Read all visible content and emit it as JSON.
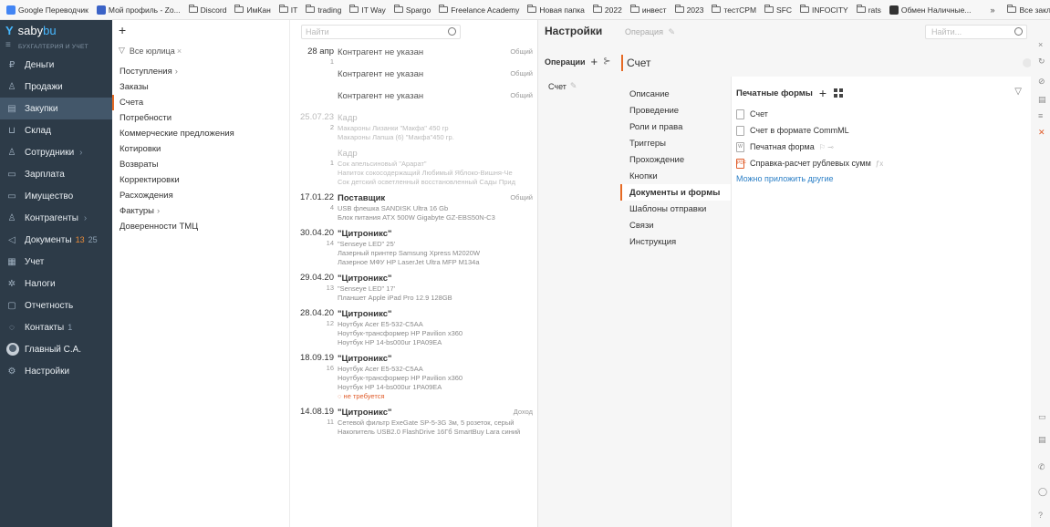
{
  "bookmarks": {
    "items": [
      {
        "label": "Google Переводчик",
        "type": "site",
        "color": "#4285f4"
      },
      {
        "label": "Мой профиль - Zo...",
        "type": "site",
        "color": "#3b63c7"
      },
      {
        "label": "Discord",
        "type": "folder"
      },
      {
        "label": "ИмКан",
        "type": "folder"
      },
      {
        "label": "IT",
        "type": "folder"
      },
      {
        "label": "trading",
        "type": "folder"
      },
      {
        "label": "IT Way",
        "type": "folder"
      },
      {
        "label": "Spargo",
        "type": "folder"
      },
      {
        "label": "Freelance Academy",
        "type": "folder"
      },
      {
        "label": "Новая папка",
        "type": "folder"
      },
      {
        "label": "2022",
        "type": "folder"
      },
      {
        "label": "инвест",
        "type": "folder"
      },
      {
        "label": "2023",
        "type": "folder"
      },
      {
        "label": "тестCPM",
        "type": "folder"
      },
      {
        "label": "SFC",
        "type": "folder"
      },
      {
        "label": "INFOCITY",
        "type": "folder"
      },
      {
        "label": "rats",
        "type": "folder"
      },
      {
        "label": "Обмен Наличные...",
        "type": "site",
        "color": "#333333"
      }
    ],
    "more": "»",
    "all_label": "Все заклад"
  },
  "sidebar": {
    "logo_a": "saby",
    "logo_b": "bu",
    "subtitle": "БУХГАЛТЕРИЯ И УЧЕТ",
    "items": [
      {
        "label": "Деньги",
        "icon": "₽",
        "arrow": "",
        "count": "",
        "count2": ""
      },
      {
        "label": "Продажи",
        "icon": "♙",
        "arrow": "",
        "count": "",
        "count2": ""
      },
      {
        "label": "Закупки",
        "icon": "▤",
        "arrow": "",
        "count": "",
        "count2": ""
      },
      {
        "label": "Склад",
        "icon": "⊔",
        "arrow": "",
        "count": "",
        "count2": ""
      },
      {
        "label": "Сотрудники",
        "icon": "♙",
        "arrow": "›",
        "count": "",
        "count2": ""
      },
      {
        "label": "Зарплата",
        "icon": "▭",
        "arrow": "",
        "count": "",
        "count2": ""
      },
      {
        "label": "Имущество",
        "icon": "▭",
        "arrow": "",
        "count": "",
        "count2": ""
      },
      {
        "label": "Контрагенты",
        "icon": "♙",
        "arrow": "›",
        "count": "",
        "count2": ""
      },
      {
        "label": "Документы",
        "icon": "◁",
        "arrow": "",
        "count": "13",
        "count2": "25"
      },
      {
        "label": "Учет",
        "icon": "▦",
        "arrow": "",
        "count": "",
        "count2": ""
      },
      {
        "label": "Налоги",
        "icon": "✲",
        "arrow": "",
        "count": "",
        "count2": ""
      },
      {
        "label": "Отчетность",
        "icon": "▢",
        "arrow": "",
        "count": "",
        "count2": ""
      },
      {
        "label": "Контакты",
        "icon": "◌",
        "arrow": "",
        "count": "",
        "count2": "1"
      },
      {
        "label": "Главный С.А.",
        "icon": "avatar",
        "arrow": "",
        "count": "",
        "count2": ""
      },
      {
        "label": "Настройки",
        "icon": "⚙",
        "arrow": "",
        "count": "",
        "count2": ""
      }
    ],
    "active_index": 2,
    "accent": "#47b8ff"
  },
  "col2": {
    "plus": "+",
    "filter_label": "Все юрлица",
    "items": [
      {
        "label": "Поступления",
        "arrow": "›"
      },
      {
        "label": "Заказы",
        "arrow": ""
      },
      {
        "label": "Счета",
        "arrow": ""
      },
      {
        "label": "Потребности",
        "arrow": ""
      },
      {
        "label": "Коммерческие предложения",
        "arrow": ""
      },
      {
        "label": "Котировки",
        "arrow": ""
      },
      {
        "label": "Возвраты",
        "arrow": ""
      },
      {
        "label": "Корректировки",
        "arrow": ""
      },
      {
        "label": "Расхождения",
        "arrow": ""
      },
      {
        "label": "Фактуры",
        "arrow": "›"
      },
      {
        "label": "Доверенности ТМЦ",
        "arrow": ""
      }
    ],
    "selected_index": 2
  },
  "list": {
    "search_placeholder": "Найти",
    "rows": [
      {
        "date": "28 апр",
        "num": "1",
        "title": "Контрагент не указан",
        "tag": "Общий",
        "muted": false,
        "bold": false,
        "subs": []
      },
      {
        "date": "",
        "num": "",
        "title": "Контрагент не указан",
        "tag": "Общий",
        "muted": false,
        "bold": false,
        "subs": []
      },
      {
        "date": "",
        "num": "",
        "title": "Контрагент не указан",
        "tag": "Общий",
        "muted": false,
        "bold": false,
        "subs": []
      },
      {
        "date": "25.07.23",
        "num": "2",
        "title": "Кадр",
        "tag": "",
        "muted": true,
        "bold": false,
        "subs": [
          "Макароны Лизанки \"Макфа\" 450 гр",
          "Макароны Лапша (6) \"Макфа\"450 гр."
        ],
        "faint": true
      },
      {
        "date": "",
        "num": "1",
        "title": "Кадр",
        "tag": "",
        "muted": true,
        "bold": false,
        "subs": [
          "Сок апельсиновый \"Арарат\"",
          "Напиток сокосодержащий Любимый Яблоко-Вишня-Че",
          "Сок детский осветленный восстановленный Сады Прид"
        ],
        "faint": true
      },
      {
        "date": "17.01.22",
        "num": "4",
        "title": "Поставщик",
        "tag": "Общий",
        "muted": false,
        "bold": true,
        "subs": [
          "USB флешка SANDISK Ultra 16 Gb",
          "Блок питания ATX 500W Gigabyte GZ-EBS50N-C3"
        ]
      },
      {
        "date": "30.04.20",
        "num": "14",
        "title": "\"Цитроникс\"",
        "tag": "",
        "muted": false,
        "bold": true,
        "subs": [
          "\"Senseye LED\" 25'",
          "Лазерный принтер Samsung Xpress M2020W",
          "Лазерное МФУ HP LaserJet Ultra MFP M134a"
        ]
      },
      {
        "date": "29.04.20",
        "num": "13",
        "title": "\"Цитроникс\"",
        "tag": "",
        "muted": false,
        "bold": true,
        "subs": [
          "\"Senseye LED\" 17'",
          "Планшет Apple iPad Pro 12.9 128GB"
        ]
      },
      {
        "date": "28.04.20",
        "num": "12",
        "title": "\"Цитроникс\"",
        "tag": "",
        "muted": false,
        "bold": true,
        "subs": [
          "Ноутбук Acer E5-532-C5AA",
          "Ноутбук-трансформер HP Pavilion x360",
          "Ноутбук HP 14-bs000ur 1PA09EA"
        ]
      },
      {
        "date": "18.09.19",
        "num": "16",
        "title": "\"Цитроникс\"",
        "tag": "",
        "muted": false,
        "bold": true,
        "subs": [
          "Ноутбук Acer E5-532-C5AA",
          "Ноутбук-трансформер HP Pavilion x360",
          "Ноутбук HP 14-bs000ur 1PA09EA"
        ],
        "warn": "не требуется"
      },
      {
        "date": "14.08.19",
        "num": "11",
        "title": "\"Цитроникс\"",
        "tag": "Доход",
        "muted": false,
        "bold": true,
        "subs": [
          "Сетевой фильтр ExeGate SP-5-3G 3м, 5 розеток, серый",
          "Накопитель USB2.0 FlashDrive 16Гб SmartBuy Lara синий"
        ]
      }
    ]
  },
  "settings": {
    "title": "Настройки",
    "ops_label": "Операции",
    "ops_plus": "+",
    "account_item": "Счет",
    "operation_label": "Операция",
    "search_placeholder": "Найти...",
    "op_name": "Счет",
    "menu": [
      "Описание",
      "Проведение",
      "Роли и права",
      "Триггеры",
      "Прохождение",
      "Кнопки",
      "Документы и формы",
      "Шаблоны отправки",
      "Связи",
      "Инструкция"
    ],
    "menu_selected": 6,
    "print_forms_title": "Печатные формы",
    "print_forms": [
      {
        "label": "Счет",
        "icon": "doc"
      },
      {
        "label": "Счет в формате CommML",
        "icon": "doc"
      },
      {
        "label": "Печатная форма",
        "icon": "W",
        "extra": "⚐ ⊸"
      },
      {
        "label": "Справка-расчет рублевых сумм",
        "icon": "pdf",
        "extra": "ƒx"
      }
    ],
    "attach_link": "Можно приложить другие",
    "accent": "#e66a24",
    "link_color": "#2b7fc6"
  }
}
